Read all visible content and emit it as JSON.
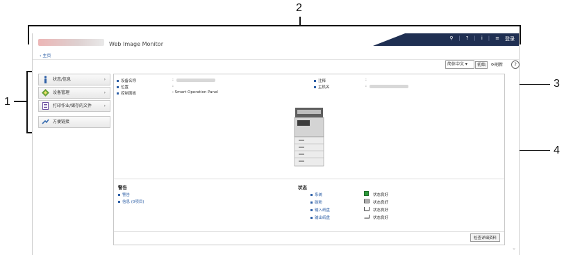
{
  "callouts": {
    "c1": "1",
    "c2": "2",
    "c3": "3",
    "c4": "4"
  },
  "header": {
    "app_title": "Web Image Monitor",
    "login": "登录",
    "home": "主页"
  },
  "toolbar": {
    "language": "简体中文",
    "init": "初始",
    "refresh": "刷新",
    "help": "?"
  },
  "sidebar": {
    "items": [
      {
        "label": "状态/信息"
      },
      {
        "label": "设备管理"
      },
      {
        "label": "打印作业/储存的文件"
      }
    ],
    "favorites": "方便链接"
  },
  "device_info": {
    "name_label": "设备名称",
    "location_label": "位置",
    "panel_label": "控制面板",
    "panel_value": ": Smart Operation Panel",
    "comment_label": "注释",
    "host_label": "主机名",
    "colon": ":"
  },
  "alerts": {
    "title": "警告",
    "warning": "警告",
    "message": "信息 (0项目)"
  },
  "status": {
    "title": "状态",
    "rows": [
      {
        "label": "系统",
        "value": "状态良好"
      },
      {
        "label": "碳粉",
        "value": "状态良好"
      },
      {
        "label": "输入纸盘",
        "value": "状态良好"
      },
      {
        "label": "输出纸盘",
        "value": "状态良好"
      }
    ]
  },
  "details_button": "检查详细资料"
}
